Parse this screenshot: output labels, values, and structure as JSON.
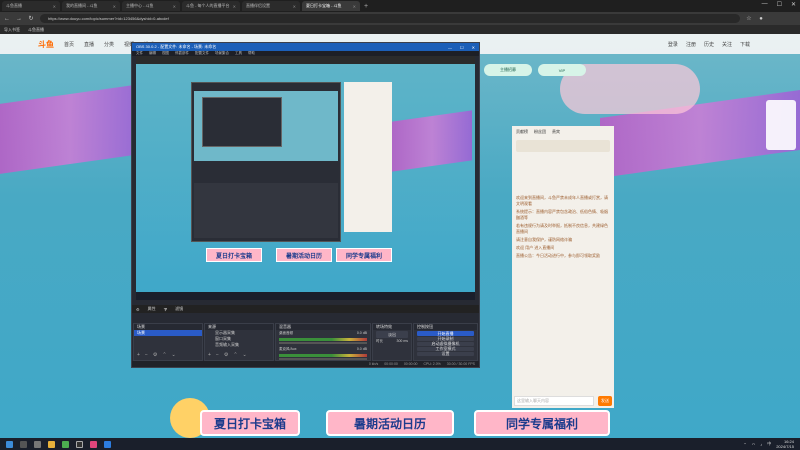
{
  "browser": {
    "tabs": [
      {
        "label": "斗鱼直播",
        "active": false
      },
      {
        "label": "我的直播间 - 斗鱼",
        "active": false
      },
      {
        "label": "主播中心 - 斗鱼",
        "active": false
      },
      {
        "label": "斗鱼 - 每个人的直播平台",
        "active": false
      },
      {
        "label": "直播伴侣设置",
        "active": false
      },
      {
        "label": "夏日打卡宝箱 - 斗鱼",
        "active": true
      }
    ],
    "url": "https://www.douyu.com/topic/summer?rid=123456&dyshid=0-abcdef",
    "bookmarks": [
      "导入书签",
      "斗鱼直播"
    ]
  },
  "site": {
    "logo": "斗鱼",
    "nav": [
      "首页",
      "直播",
      "分类",
      "视频",
      "游戏"
    ],
    "header_right": [
      "登录",
      "注册",
      "历史",
      "关注",
      "下载"
    ]
  },
  "banners": [
    "夏日打卡宝箱",
    "暑期活动日历",
    "同学专属福利"
  ],
  "top_buttons": [
    "主播招募",
    "VIP"
  ],
  "chat": {
    "tabs": [
      "贡献榜",
      "粉丝团",
      "贵宾"
    ],
    "lines": [
      "欢迎来到直播间，斗鱼严禁未成年人直播或打赏，请文明观看",
      "系统提示：直播内容严禁包含政治、低俗色情、吸烟酗酒等",
      "若有违规行为请及时举报，抵制不良信息，共建绿色直播间",
      "请注意自我保护，谨防网络诈骗",
      "欢迎 用户 进入直播间",
      "直播公告：今日活动进行中，参与即可领取奖励"
    ],
    "placeholder": "这里输入聊天内容",
    "send_label": "发送"
  },
  "obs": {
    "title": "OBS 30.0.2 - 配置文件: 未命名 - 场景: 未命名",
    "menu": [
      "文件",
      "编辑",
      "视图",
      "停靠部件",
      "配置文件",
      "场景集合",
      "工具",
      "帮助"
    ],
    "bar": [
      "属性",
      "滤镜"
    ],
    "scenes_title": "场景",
    "scenes": [
      "场景"
    ],
    "sources_title": "来源",
    "sources": [
      "显示器采集",
      "窗口采集",
      "音频输入采集"
    ],
    "mixer_title": "混音器",
    "mixer_channels": [
      {
        "name": "桌面音频",
        "db": "0.0 dB"
      },
      {
        "name": "麦克风/Aux",
        "db": "0.0 dB"
      }
    ],
    "transitions_title": "转场特效",
    "transition_value": "淡出",
    "duration_label": "时长",
    "duration_value": "300 ms",
    "controls_title": "控制按钮",
    "controls": [
      "开始直播",
      "开始录制",
      "启动虚拟摄像机",
      "工作室模式",
      "设置",
      "退出"
    ],
    "status": [
      "0 kb/s",
      "00:00:00",
      "00:00:00",
      "CPU: 2.0%",
      "30.00 / 30.00 FPS"
    ]
  },
  "taskbar": {
    "time": "16:24",
    "date": "2024/7/15",
    "lang": "中"
  },
  "colors": {
    "obs_bg": "#272a33",
    "obs_primary": "#2a5bc7",
    "site_accent": "#ff6a00",
    "banner_bg": "#ffb6c8"
  }
}
